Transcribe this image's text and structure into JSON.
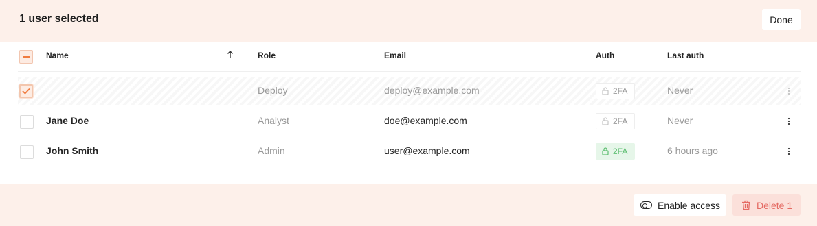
{
  "header": {
    "title": "1 user selected",
    "done_label": "Done"
  },
  "table": {
    "columns": {
      "name": "Name",
      "role": "Role",
      "email": "Email",
      "auth": "Auth",
      "last_auth": "Last auth"
    },
    "sort": {
      "column": "Name",
      "direction": "ascending",
      "icon": "arrow-up-icon"
    },
    "rows": [
      {
        "name": "",
        "role": "Deploy",
        "email": "deploy@example.com",
        "auth": "2FA",
        "auth_enabled": false,
        "last_auth": "Never",
        "selected": true
      },
      {
        "name": "Jane Doe",
        "role": "Analyst",
        "email": "doe@example.com",
        "auth": "2FA",
        "auth_enabled": false,
        "last_auth": "Never",
        "selected": false
      },
      {
        "name": "John Smith",
        "role": "Admin",
        "email": "user@example.com",
        "auth": "2FA",
        "auth_enabled": true,
        "last_auth": "6 hours ago",
        "selected": false
      }
    ]
  },
  "footer": {
    "enable_label": "Enable access",
    "delete_label": "Delete 1"
  },
  "colors": {
    "accent": "#f07b3f",
    "bar_background": "#fdf0ea",
    "success": "#5fbf72",
    "danger": "#e56a63"
  }
}
